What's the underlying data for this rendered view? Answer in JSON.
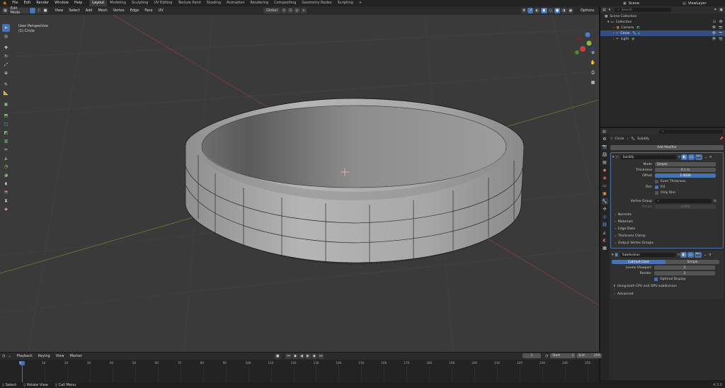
{
  "menu": {
    "items": [
      "File",
      "Edit",
      "Render",
      "Window",
      "Help"
    ]
  },
  "workspaces": [
    {
      "label": "Layout",
      "active": true
    },
    {
      "label": "Modeling"
    },
    {
      "label": "Sculpting"
    },
    {
      "label": "UV Editing"
    },
    {
      "label": "Texture Paint"
    },
    {
      "label": "Shading"
    },
    {
      "label": "Animation"
    },
    {
      "label": "Rendering"
    },
    {
      "label": "Compositing"
    },
    {
      "label": "Geometry Nodes"
    },
    {
      "label": "Scripting"
    }
  ],
  "scene": {
    "name": "Scene",
    "view_layer": "ViewLayer"
  },
  "viewport_header": {
    "mode": "Edit Mode",
    "menus": [
      "View",
      "Select",
      "Add",
      "Mesh",
      "Vertex",
      "Edge",
      "Face",
      "UV"
    ],
    "transform_orientation": "Global",
    "options": "Options"
  },
  "viewport": {
    "view_name": "User Perspective",
    "object_name": "(1) Circle"
  },
  "outliner": {
    "search_placeholder": "Search",
    "root": "Scene Collection",
    "collection": "Collection",
    "items": [
      "Camera",
      "Circle",
      "Light"
    ]
  },
  "properties": {
    "breadcrumb_object": "Circle",
    "breadcrumb_modifier": "Solidify",
    "add_modifier": "Add Modifier",
    "solidify": {
      "name": "Solidify",
      "mode_label": "Mode",
      "mode_value": "Simple",
      "thickness_label": "Thickness",
      "thickness_value": "0.1 m",
      "offset_label": "Offset",
      "offset_value": "1.0000",
      "even_thickness": "Even Thickness",
      "rim_label": "Rim",
      "fill": "Fill",
      "only_rim": "Only Rim",
      "vertex_group_label": "Vertex Group",
      "factor_label": "Factor",
      "factor_value": "0.000",
      "sections": [
        "Normals",
        "Materials",
        "Edge Data",
        "Thickness Clamp",
        "Output Vertex Groups"
      ]
    },
    "subdivision": {
      "name": "Subdivision",
      "catmull": "Catmull-Clark",
      "simple": "Simple",
      "levels_viewport_label": "Levels Viewport",
      "levels_viewport_value": "2",
      "render_label": "Render",
      "render_value": "2",
      "optimal_display": "Optimal Display",
      "gpu_note": "Using both CPU and GPU subdivision",
      "advanced": "Advanced"
    }
  },
  "timeline": {
    "menus": [
      "Playback",
      "Keying",
      "View",
      "Marker"
    ],
    "current_frame": "1",
    "start_label": "Start",
    "start_value": "1",
    "end_label": "End",
    "end_value": "250",
    "ticks": [
      "0",
      "10",
      "20",
      "30",
      "40",
      "50",
      "60",
      "70",
      "80",
      "90",
      "100",
      "110",
      "120",
      "130",
      "140",
      "150",
      "160",
      "170",
      "180",
      "190",
      "200",
      "210",
      "220",
      "230",
      "240",
      "250"
    ]
  },
  "statusbar": {
    "select": "Select",
    "rotate": "Rotate View",
    "call_menu": "Call Menu",
    "version": "4.3.0"
  }
}
